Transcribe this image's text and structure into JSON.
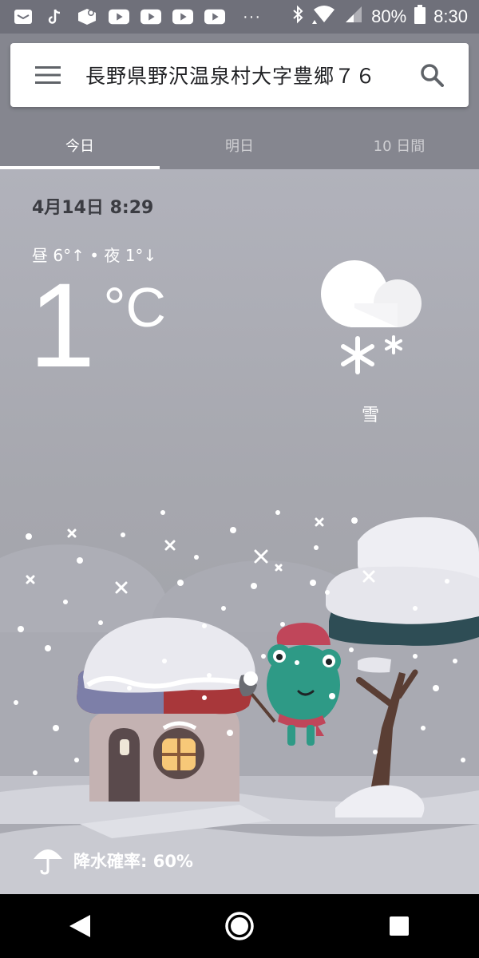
{
  "status_bar": {
    "battery": "80%",
    "time": "8:30",
    "left_icons": [
      "mail-icon",
      "tiktok-icon",
      "app-icon",
      "youtube-icon",
      "youtube-icon",
      "youtube-icon",
      "youtube-icon"
    ],
    "more": "···"
  },
  "header": {
    "location": "長野県野沢温泉村大字豊郷７６",
    "menu_icon": "menu-icon",
    "search_icon": "search-icon"
  },
  "tabs": [
    {
      "label": "今日",
      "active": true
    },
    {
      "label": "明日",
      "active": false
    },
    {
      "label": "10 日間",
      "active": false
    }
  ],
  "weather": {
    "datetime": "4月14日 8:29",
    "hilo": "昼 6°↑ • 夜 1°↓",
    "temp": "1",
    "unit": "°C",
    "condition": "雪",
    "precip": "降水確率: 60%"
  },
  "colors": {
    "status_bar": "#6f707a",
    "header_bg": "#85868f",
    "sky_top": "#b1b2bb",
    "ground": "#c9cad1",
    "frog": "#2e9a86"
  }
}
